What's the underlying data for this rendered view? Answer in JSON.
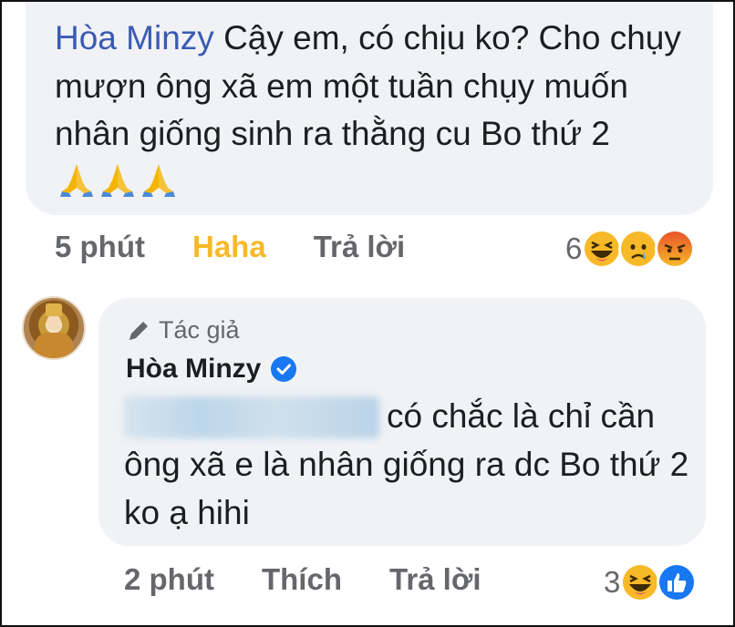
{
  "comment1": {
    "author": "Hòa Minzy",
    "text": "Cậy em, có chịu ko? Cho chụy mượn ông xã em một tuần chụy muốn nhân giống sinh ra thằng cu Bo thứ 2",
    "emoji": [
      "folded-hands",
      "folded-hands",
      "folded-hands"
    ],
    "actions": {
      "time": "5 phút",
      "reaction": "Haha",
      "reply": "Trả lời"
    },
    "reaction_count": "6",
    "reactions": [
      "haha",
      "sad",
      "angry"
    ]
  },
  "comment2": {
    "badge": "Tác giả",
    "author": "Hòa Minzy",
    "text": "có chắc là chỉ cần ông xã e là nhân giống ra dc Bo thứ 2 ko ạ hihi",
    "actions": {
      "time": "2 phút",
      "like": "Thích",
      "reply": "Trả lời"
    },
    "reaction_count": "3",
    "reactions": [
      "haha",
      "like"
    ]
  },
  "colors": {
    "bubble": "#f0f2f5",
    "mention": "#3a5ab5",
    "haha": "#f7b928",
    "meta": "#65676b",
    "like_blue": "#1877f2"
  }
}
